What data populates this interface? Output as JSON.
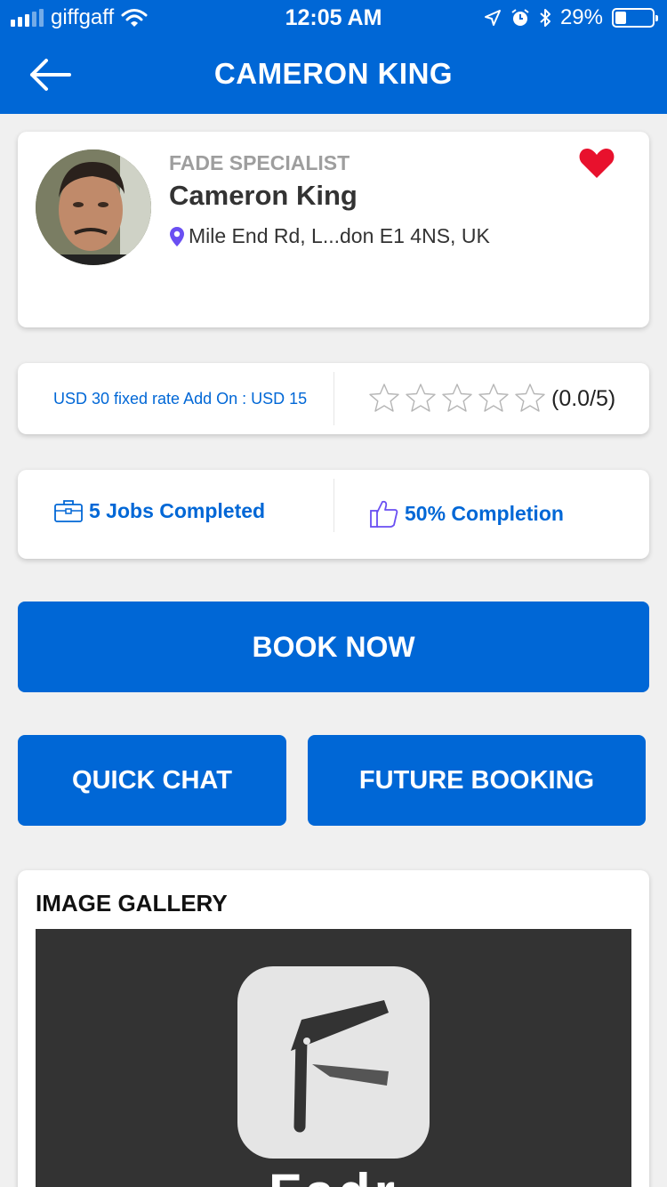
{
  "status_bar": {
    "carrier": "giffgaff",
    "time": "12:05 AM",
    "battery_percent": "29%",
    "battery_level": 0.29,
    "icons": [
      "signal-icon",
      "wifi-icon",
      "location-icon",
      "alarm-icon",
      "bluetooth-icon",
      "battery-icon"
    ]
  },
  "header": {
    "title": "CAMERON KING",
    "back_icon": "arrow-left-icon"
  },
  "profile": {
    "specialty": "FADE SPECIALIST",
    "name": "Cameron King",
    "location": "Mile End Rd, L...don E1 4NS, UK",
    "favorite": true,
    "favorite_color": "#e8112d"
  },
  "pricing": {
    "text": "USD 30 fixed rate Add On : USD 15"
  },
  "rating": {
    "stars_filled": 0,
    "stars_total": 5,
    "text": "(0.0/5)"
  },
  "stats": {
    "jobs": "5 Jobs Completed",
    "completion": "50% Completion"
  },
  "buttons": {
    "book_now": "BOOK NOW",
    "quick_chat": "QUICK CHAT",
    "future_booking": "FUTURE BOOKING"
  },
  "gallery": {
    "title": "IMAGE GALLERY",
    "app_name": "Fadr"
  },
  "colors": {
    "brand": "#0067d6",
    "muted_text": "#9e9e9e"
  }
}
